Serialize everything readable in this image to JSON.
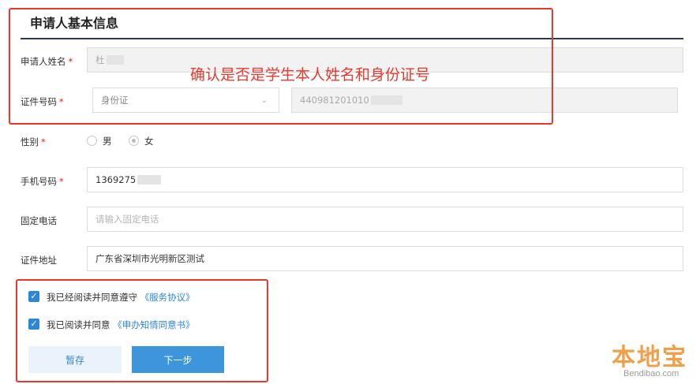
{
  "section": {
    "title": "申请人基本信息"
  },
  "fields": {
    "name": {
      "label": "申请人姓名",
      "value": "杜"
    },
    "id_type": {
      "label": "证件号码",
      "selected": "身份证",
      "number": "440981201010"
    },
    "gender": {
      "label": "性别",
      "options": [
        "男",
        "女"
      ],
      "selected": "女"
    },
    "mobile": {
      "label": "手机号码",
      "value": "1369275"
    },
    "landline": {
      "label": "固定电话",
      "placeholder": "请输入固定电话"
    },
    "address": {
      "label": "证件地址",
      "value": "广东省深圳市光明新区测试"
    }
  },
  "required_mark": "*",
  "agreements": [
    {
      "text": "我已经阅读并同意遵守",
      "link": "《服务协议》",
      "checked": true
    },
    {
      "text": "我已阅读并同意",
      "link": "《申办知情同意书》",
      "checked": true
    }
  ],
  "buttons": {
    "save": "暂存",
    "next": "下一步"
  },
  "annotation": "确认是否是学生本人姓名和身份证号",
  "watermark": {
    "main": "本地宝",
    "sub": "Bendibao.com"
  },
  "colors": {
    "accent": "#2d86d6",
    "highlight": "#e8392f",
    "required": "#e02020"
  },
  "icons": {
    "checkbox": "check-icon",
    "select": "chevron-down-icon"
  }
}
